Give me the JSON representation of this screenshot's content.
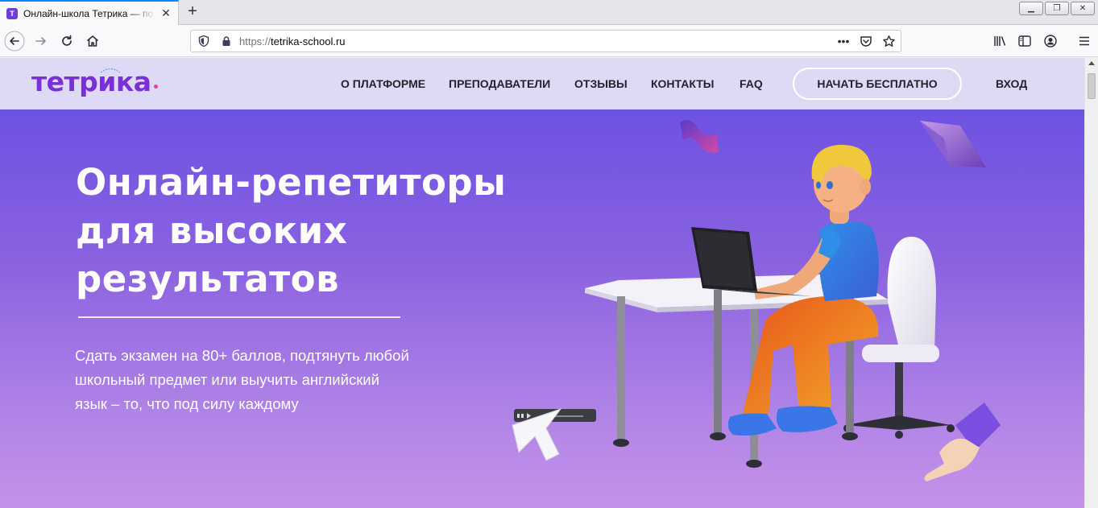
{
  "browser": {
    "tab": {
      "favicon": "Т",
      "title": "Онлайн-школа Тетрика — по",
      "close": "✕"
    },
    "new_tab": "+",
    "window_buttons": [
      "▁",
      "❐",
      "✕"
    ],
    "address": {
      "scheme": "https://",
      "host": "tetrika-school.ru"
    },
    "icons": [
      "back-icon",
      "forward-icon",
      "reload-icon",
      "home-icon",
      "shield-icon",
      "lock-icon",
      "page-actions-icon",
      "pocket-icon",
      "bookmark-star-icon",
      "library-icon",
      "sidebar-icon",
      "account-icon",
      "menu-icon"
    ]
  },
  "site": {
    "logo": "тетрика",
    "nav": [
      "О ПЛАТФОРМЕ",
      "ПРЕПОДАВАТЕЛИ",
      "ОТЗЫВЫ",
      "КОНТАКТЫ",
      "FAQ"
    ],
    "cta": "НАЧАТЬ БЕСПЛАТНО",
    "login": "ВХОД",
    "hero": {
      "title_lines": [
        "Онлайн-репетиторы",
        "для высоких",
        "результатов"
      ],
      "subtitle_lines": [
        "Сдать экзамен на 80+ баллов, подтянуть любой",
        "школьный предмет или выучить английский",
        "язык – то, что под силу каждому"
      ]
    },
    "colors": {
      "brand": "#7b2fd6",
      "header_bg": "#dedaf6",
      "hero_top": "#6e52e2",
      "hero_bottom": "#c492ea"
    }
  }
}
